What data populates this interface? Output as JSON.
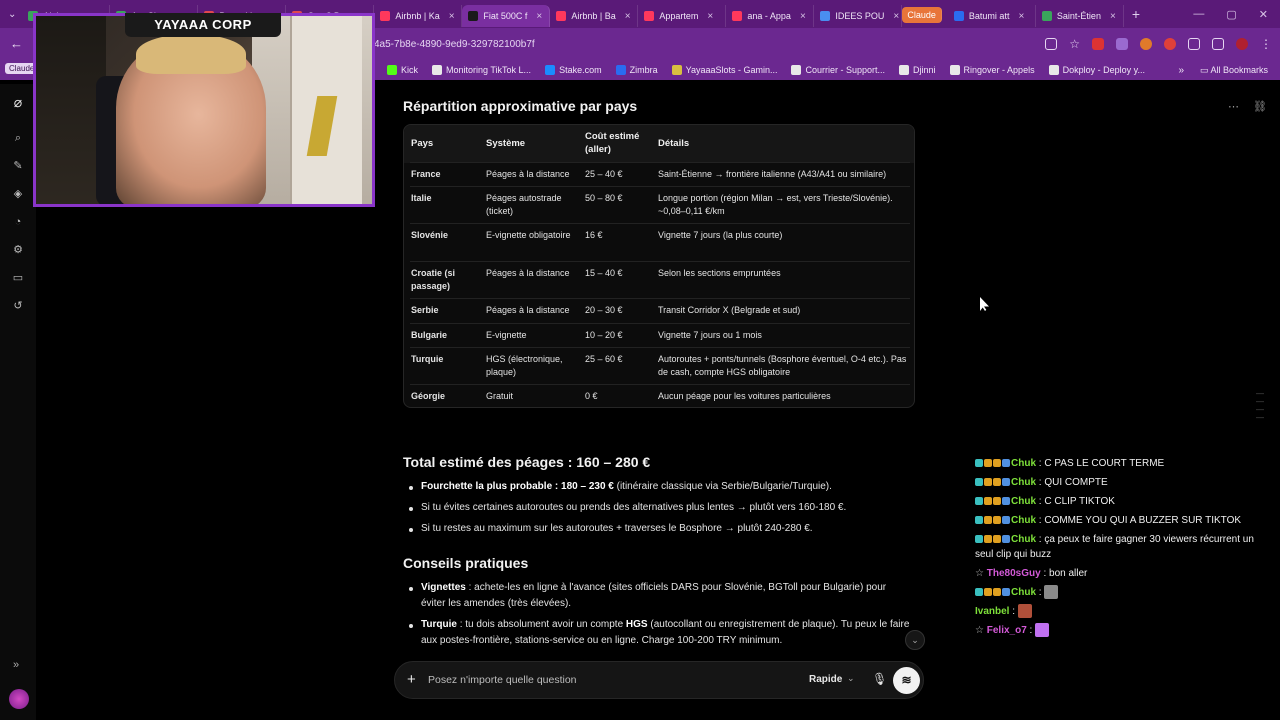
{
  "browser": {
    "tabs": [
      {
        "label": "Alala...",
        "color": "#3aa55c"
      },
      {
        "label": "Ant Chat...",
        "color": "#3aa55c"
      },
      {
        "label": "Batumi I...",
        "color": "#e0484f"
      },
      {
        "label": "Cap 8 Ba...",
        "color": "#e0484f"
      },
      {
        "label": "Airbnb | Ka",
        "color": "#ff385c"
      },
      {
        "label": "Fiat 500C f",
        "color": "#1a1a1a",
        "active": true
      },
      {
        "label": "Airbnb | Ba",
        "color": "#ff385c"
      },
      {
        "label": "Appartem",
        "color": "#ff385c"
      },
      {
        "label": "ana - Appa",
        "color": "#ff385c"
      },
      {
        "label": "IDEES POU",
        "color": "#4a8ef0"
      },
      {
        "label": "Claude",
        "color": "#e8753a",
        "claude": true
      },
      {
        "label": "Batumi att",
        "color": "#2a6cf0"
      },
      {
        "label": "Saint-Étien",
        "color": "#3aa55c"
      }
    ],
    "url": "4a5-7b8e-4890-9ed9-329782100b7f",
    "claude_chip": "Claude",
    "bookmarks": [
      "Kick",
      "Monitoring TikTok L...",
      "Stake.com",
      "Zimbra",
      "YayaaaSlots - Gamin...",
      "Courrier - Support...",
      "Djinni",
      "Ringover - Appels",
      "Dokploy - Deploy y..."
    ],
    "all_bookmarks": "All Bookmarks"
  },
  "stream": {
    "banner": "YAYAAA CORP"
  },
  "doc": {
    "section_title": "Répartition approximative par pays",
    "table": {
      "headers": [
        "Pays",
        "Système",
        "Coût estimé (aller)",
        "Détails"
      ],
      "rows": [
        [
          "France",
          "Péages à la distance",
          "25 – 40 €",
          "Saint-Étienne → frontière italienne (A43/A41 ou similaire)"
        ],
        [
          "Italie",
          "Péages autostrade (ticket)",
          "50 – 80 €",
          "Longue portion (région Milan → est, vers Trieste/Slovénie). ~0,08–0,11 €/km"
        ],
        [
          "Slovénie",
          "E-vignette obligatoire",
          "16 €",
          "Vignette 7 jours (la plus courte)"
        ],
        [
          "Croatie (si passage)",
          "Péages à la distance",
          "15 – 40 €",
          "Selon les sections empruntées"
        ],
        [
          "Serbie",
          "Péages à la distance",
          "20 – 30 €",
          "Transit Corridor X (Belgrade et sud)"
        ],
        [
          "Bulgarie",
          "E-vignette",
          "10 – 20 €",
          "Vignette 7 jours ou 1 mois"
        ],
        [
          "Turquie",
          "HGS (électronique, plaque)",
          "25 – 60 €",
          "Autoroutes + ponts/tunnels (Bosphore éventuel, O-4 etc.). Pas de cash, compte HGS obligatoire"
        ],
        [
          "Géorgie",
          "Gratuit",
          "0 €",
          "Aucun péage pour les voitures particulières"
        ]
      ]
    },
    "total_title": "Total estimé des péages : 160 – 280 €",
    "total_bullets": [
      {
        "bold": "Fourchette la plus probable : 180 – 230 €",
        "rest": " (itinéraire classique via Serbie/Bulgarie/Turquie)."
      },
      {
        "bold": "",
        "rest": "Si tu évites certaines autoroutes ou prends des alternatives plus lentes → plutôt vers 160-180 €."
      },
      {
        "bold": "",
        "rest": "Si tu restes au maximum sur les autoroutes + traverses le Bosphore → plutôt 240-280 €."
      }
    ],
    "conseils_title": "Conseils pratiques",
    "conseils": [
      {
        "bold": "Vignettes",
        "rest": " : achete-les en ligne à l'avance (sites officiels DARS pour Slovénie, BGToll pour Bulgarie) pour éviter les amendes (très élevées)."
      },
      {
        "bold": "Turquie",
        "rest": " : tu dois absolument avoir un compte ",
        "bold2": "HGS",
        "rest2": " (autocollant ou enregistrement de plaque). Tu peux le faire aux postes-frontière, stations-service ou en ligne. Charge 100-200 TRY minimum."
      }
    ]
  },
  "composer": {
    "placeholder": "Posez n'importe quelle question",
    "model": "Rapide"
  },
  "chat": [
    {
      "user": "Chuk",
      "color": "#7ee03a",
      "text": "C PAS LE COURT TERME",
      "badges": true
    },
    {
      "user": "Chuk",
      "color": "#7ee03a",
      "text": "QUI COMPTE",
      "badges": true
    },
    {
      "user": "Chuk",
      "color": "#7ee03a",
      "text": "C CLIP TIKTOK",
      "badges": true
    },
    {
      "user": "Chuk",
      "color": "#7ee03a",
      "text": "COMME YOU QUI A BUZZER SUR TIKTOK",
      "badges": true
    },
    {
      "user": "Chuk",
      "color": "#7ee03a",
      "text": "ça peux te faire gagner 30 viewers récurrent un seul clip qui buzz",
      "badges": true
    },
    {
      "user": "The80sGuy",
      "color": "#d45ad8",
      "text": "bon aller",
      "badges": false
    },
    {
      "user": "Chuk",
      "color": "#7ee03a",
      "text": "",
      "badges": true,
      "emote": "#8a8a8a"
    },
    {
      "user": "Ivanbel",
      "color": "#7ee03a",
      "text": "",
      "badges": false,
      "emote": "#b0503a"
    },
    {
      "user": "Felix_o7",
      "color": "#d45ad8",
      "text": "",
      "badges": false,
      "emote": "#c070f0"
    }
  ]
}
